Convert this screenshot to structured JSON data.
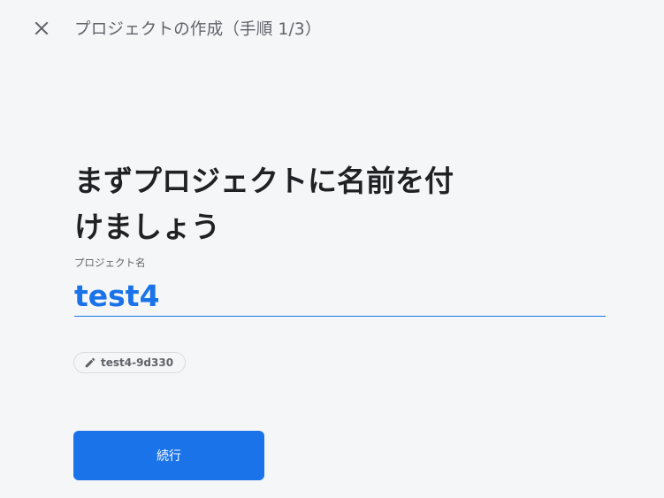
{
  "header": {
    "close_icon": "close-icon",
    "title": "プロジェクトの作成（手順 1/3）"
  },
  "main": {
    "heading_line1": "まずプロジェクトに名前を付",
    "heading_line2": "けましょう",
    "project_name": {
      "label": "プロジェクト名",
      "value": "test4"
    },
    "project_id_chip": {
      "icon": "pencil-icon",
      "label": "test4-9d330"
    },
    "continue_label": "続行"
  },
  "colors": {
    "accent": "#1a73e8",
    "background": "#f5f6f8",
    "text_primary": "#202124",
    "text_secondary": "#5f6368"
  }
}
